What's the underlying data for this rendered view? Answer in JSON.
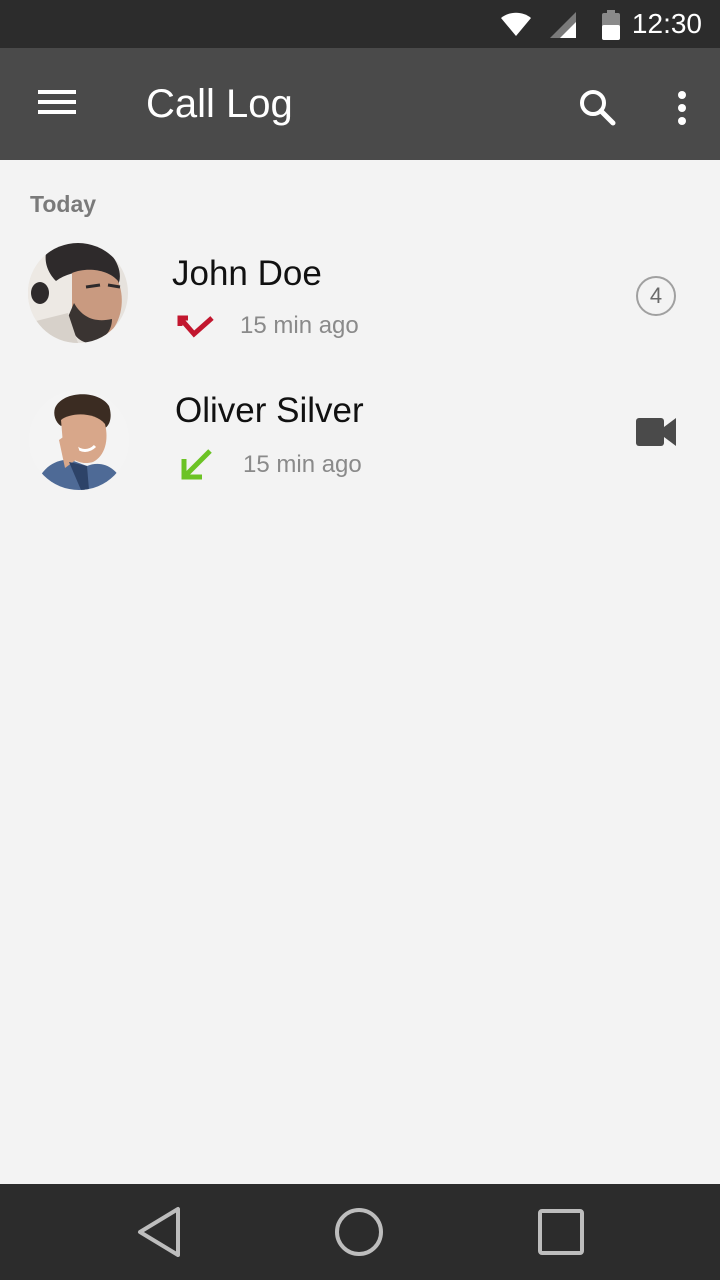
{
  "status_bar": {
    "time": "12:30",
    "icons": [
      "wifi-icon",
      "cellular-signal-icon",
      "battery-icon"
    ]
  },
  "app_bar": {
    "title": "Call Log",
    "icons": [
      "menu-icon",
      "search-icon",
      "more-vert-icon"
    ],
    "background": "#4a4a4a"
  },
  "call_log": {
    "section_label": "Today",
    "entries": [
      {
        "name": "John Doe",
        "time": "15 min ago",
        "call_type": "missed",
        "call_type_color": "#c2162e",
        "count": "4",
        "avatar_icon": "avatar-photo"
      },
      {
        "name": "Oliver Silver",
        "time": "15 min ago",
        "call_type": "incoming",
        "call_type_color": "#6cc325",
        "action_icon": "videocam-icon",
        "avatar_icon": "avatar-photo"
      }
    ]
  },
  "nav_bar": {
    "icons": [
      "back-icon",
      "home-icon",
      "recents-icon"
    ]
  },
  "colors": {
    "status_bar": "#2c2c2c",
    "page_background": "#f3f3f3",
    "missed": "#c2162e",
    "incoming": "#6cc325"
  }
}
